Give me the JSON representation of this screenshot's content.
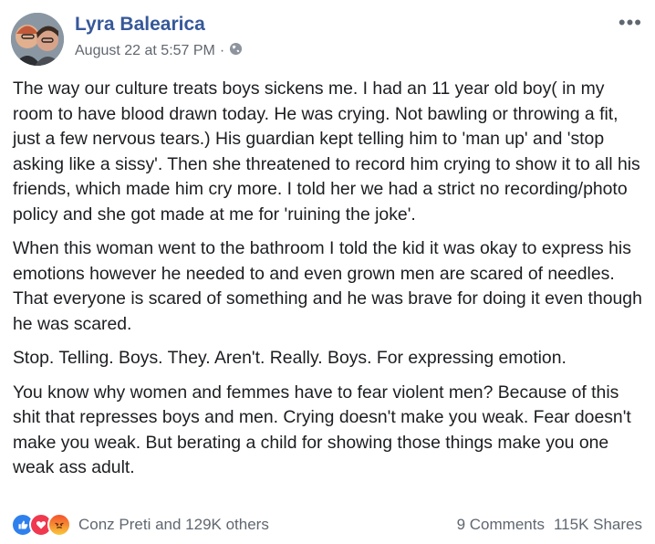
{
  "post": {
    "author": "Lyra Balearica",
    "timestamp": "August 22 at 5:57 PM",
    "separator": "·",
    "privacy_icon": "globe-icon",
    "paragraphs": [
      "The way our culture treats boys sickens me. I had an 11 year old boy( in my room to have blood drawn today. He was crying. Not bawling or throwing a fit, just a few nervous tears.) His guardian kept telling him to 'man up' and 'stop asking like a sissy'. Then she threatened to record him crying to show it to all his friends, which made him cry more. I told her we had a strict no recording/photo policy and she got made at me for 'ruining the joke'.",
      "When this woman went to the bathroom I told the kid it was okay to express his emotions however he needed to and even grown men are scared of needles. That everyone is scared of something and he was brave for doing it even though he was scared.",
      "Stop. Telling. Boys. They. Aren't. Really. Boys. For expressing emotion.",
      "You know why women and femmes have to fear violent men? Because of this shit that represses boys and men. Crying doesn't make you weak. Fear doesn't make you weak. But berating a child for showing those things make you one weak ass adult."
    ]
  },
  "footer": {
    "reactors": "Conz Preti and 129K others",
    "comments": "9 Comments",
    "shares": "115K Shares",
    "reaction_icons": [
      "like-icon",
      "love-icon",
      "angry-icon"
    ]
  },
  "colors": {
    "author": "#365899",
    "meta": "#616770",
    "text": "#1c1e21"
  }
}
